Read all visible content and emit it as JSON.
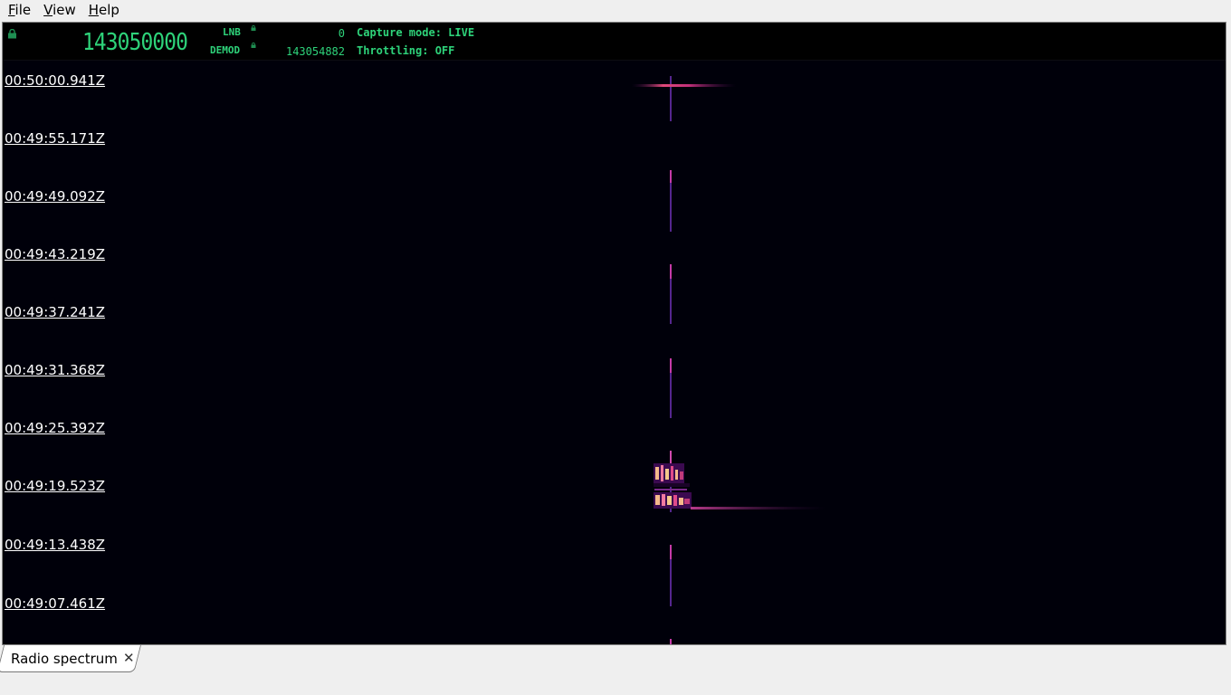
{
  "menubar": {
    "items": [
      {
        "mnemonic": "F",
        "rest": "ile"
      },
      {
        "mnemonic": "V",
        "rest": "iew"
      },
      {
        "mnemonic": "H",
        "rest": "elp"
      }
    ]
  },
  "header": {
    "frequency": "143050000",
    "lnb_label": "LNB",
    "lnb_value": "0",
    "demod_label": "DEMOD",
    "demod_value": "143054882",
    "capture_mode": "Capture mode: LIVE",
    "throttling": "Throttling: OFF",
    "accent_color": "#2ed37a"
  },
  "waterfall": {
    "timestamps": [
      "00:50:00.941Z",
      "00:49:55.171Z",
      "00:49:49.092Z",
      "00:49:43.219Z",
      "00:49:37.241Z",
      "00:49:31.368Z",
      "00:49:25.392Z",
      "00:49:19.523Z",
      "00:49:13.438Z",
      "00:49:07.461Z"
    ],
    "background_color": "#00000a"
  },
  "tabs": [
    {
      "label": "Radio spectrum"
    }
  ]
}
